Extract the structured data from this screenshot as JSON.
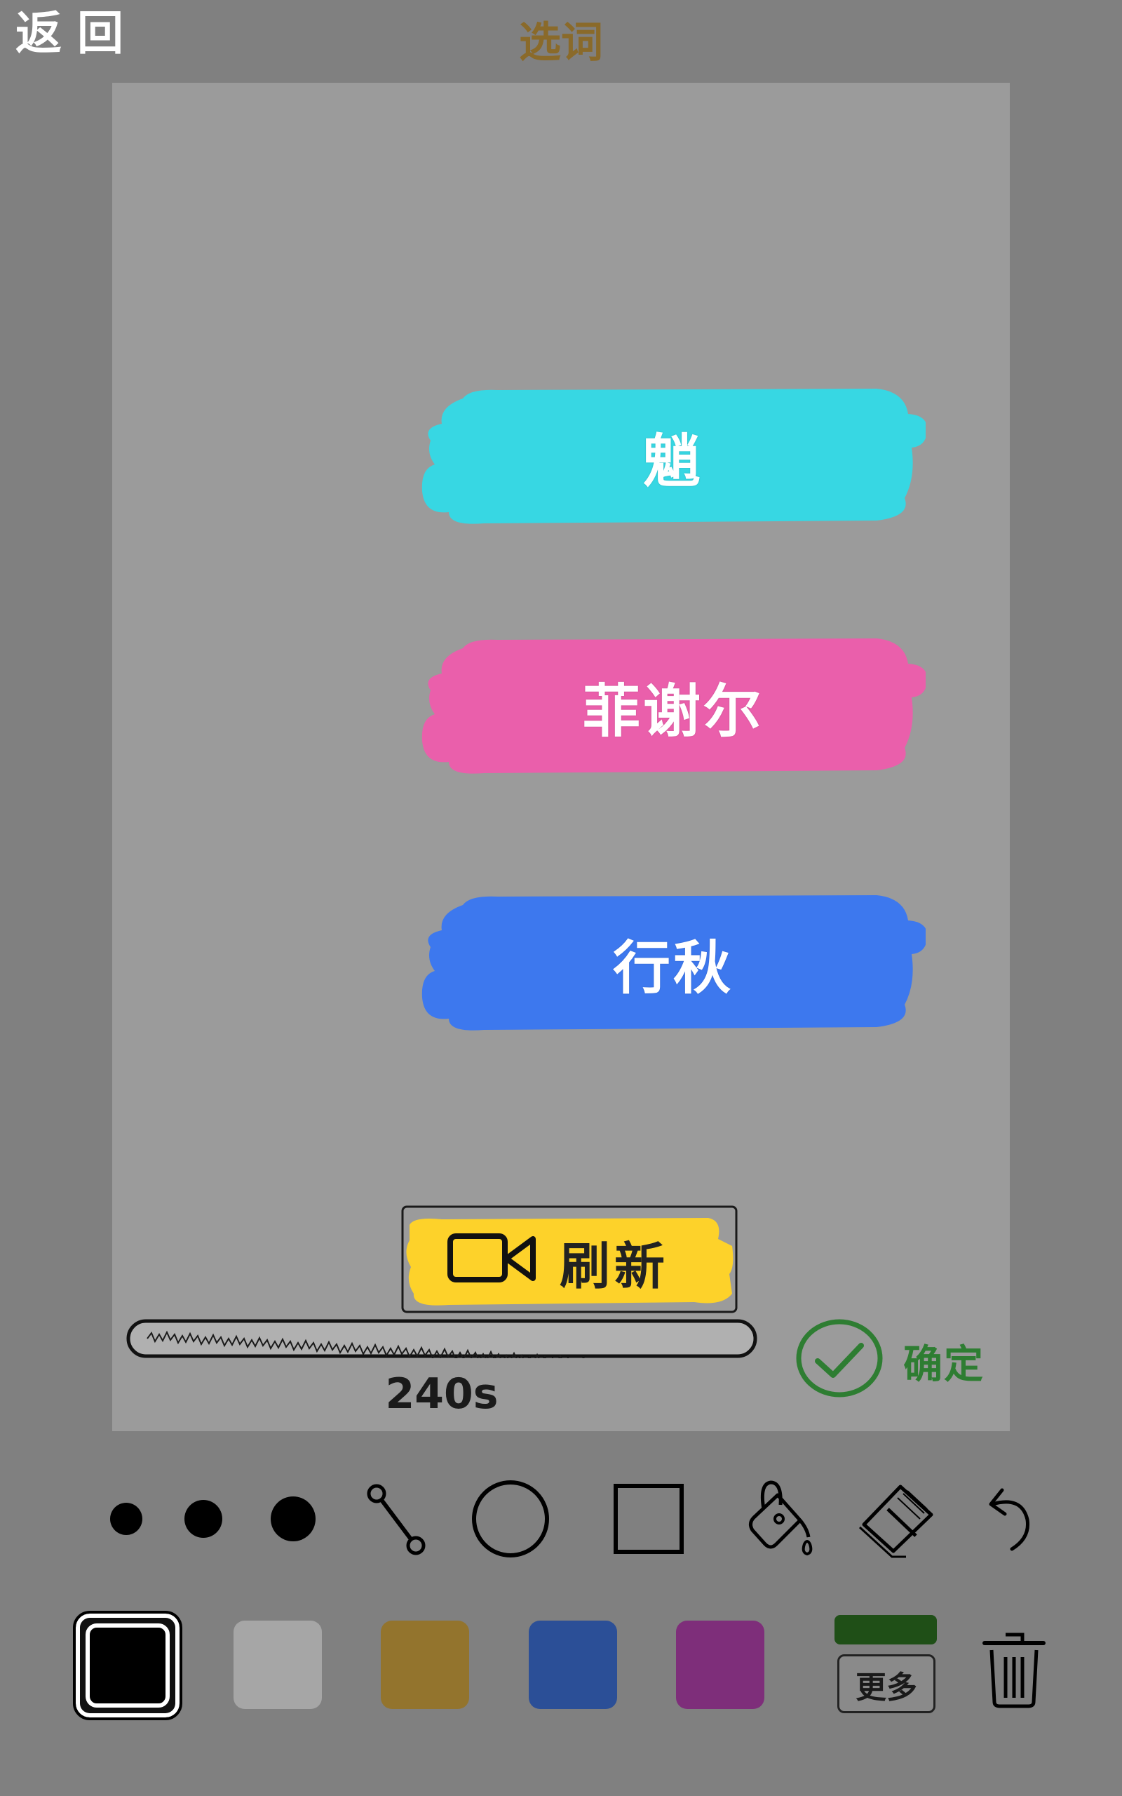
{
  "header": {
    "back_label": "返回",
    "title": "选词"
  },
  "words": [
    {
      "label": "魈",
      "color": "#37d7e3"
    },
    {
      "label": "菲谢尔",
      "color": "#ea5fab"
    },
    {
      "label": "行秋",
      "color": "#3d78ee"
    }
  ],
  "refresh": {
    "label": "刷新",
    "icon": "video-camera-icon",
    "color": "#fdd22a"
  },
  "timer": {
    "text": "240s"
  },
  "confirm": {
    "label": "确定",
    "icon": "check-circle-icon",
    "color": "#2e7d32"
  },
  "tools": [
    "brush-small",
    "brush-medium",
    "brush-large",
    "line-tool",
    "circle-tool",
    "rectangle-tool",
    "fill-bucket",
    "eraser",
    "undo"
  ],
  "palette": {
    "selected_color": "#000000",
    "colors": [
      "#a6a6a6",
      "#93742d",
      "#2b4f97",
      "#7e2e7a"
    ],
    "more_label": "更多",
    "more_color": "#1f4f17"
  }
}
